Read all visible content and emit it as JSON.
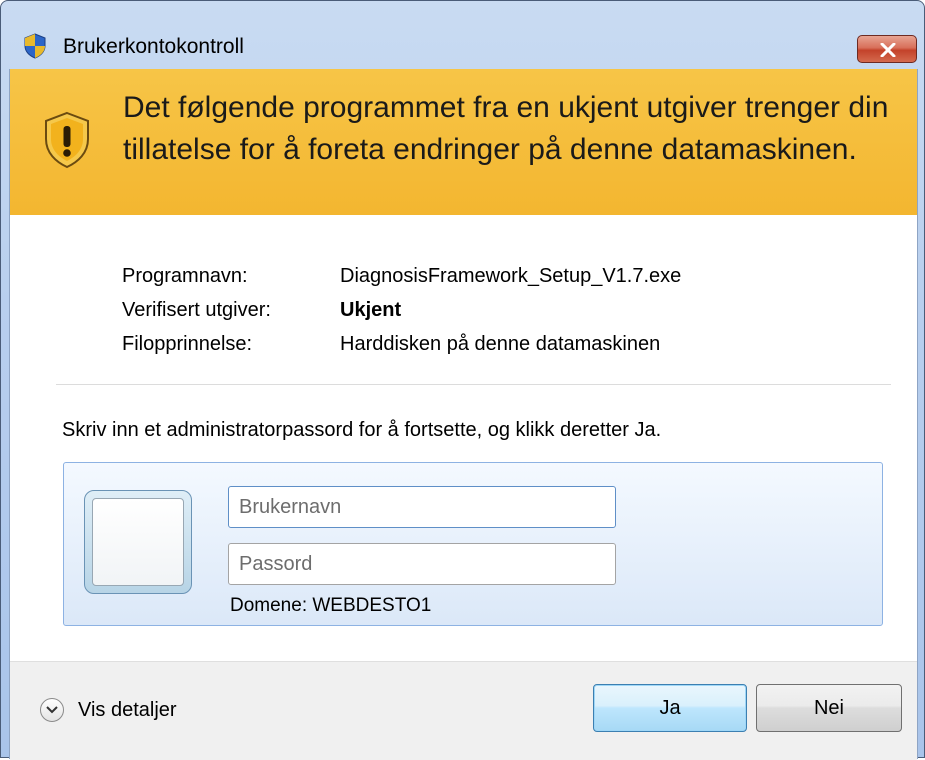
{
  "window": {
    "title": "Brukerkontokontroll"
  },
  "banner": {
    "message": "Det følgende programmet fra en ukjent utgiver trenger din tillatelse for å foreta endringer på denne datamaskinen."
  },
  "info": {
    "rows": [
      {
        "label": "Programnavn:",
        "value": "DiagnosisFramework_Setup_V1.7.exe"
      },
      {
        "label": "Verifisert utgiver:",
        "value": "Ukjent"
      },
      {
        "label": "Filopprinnelse:",
        "value": "Harddisken på denne datamaskinen"
      }
    ]
  },
  "prompt": "Skriv inn et administratorpassord for å fortsette, og klikk deretter Ja.",
  "credentials": {
    "username_placeholder": "Brukernavn",
    "password_placeholder": "Passord",
    "domain": "Domene: WEBDESTO1"
  },
  "footer": {
    "details_label": "Vis detaljer",
    "yes_label": "Ja",
    "no_label": "Nei"
  },
  "colors": {
    "banner": "#f3b630",
    "titlebar": "#b8cfee",
    "close_button": "#c3422a"
  }
}
